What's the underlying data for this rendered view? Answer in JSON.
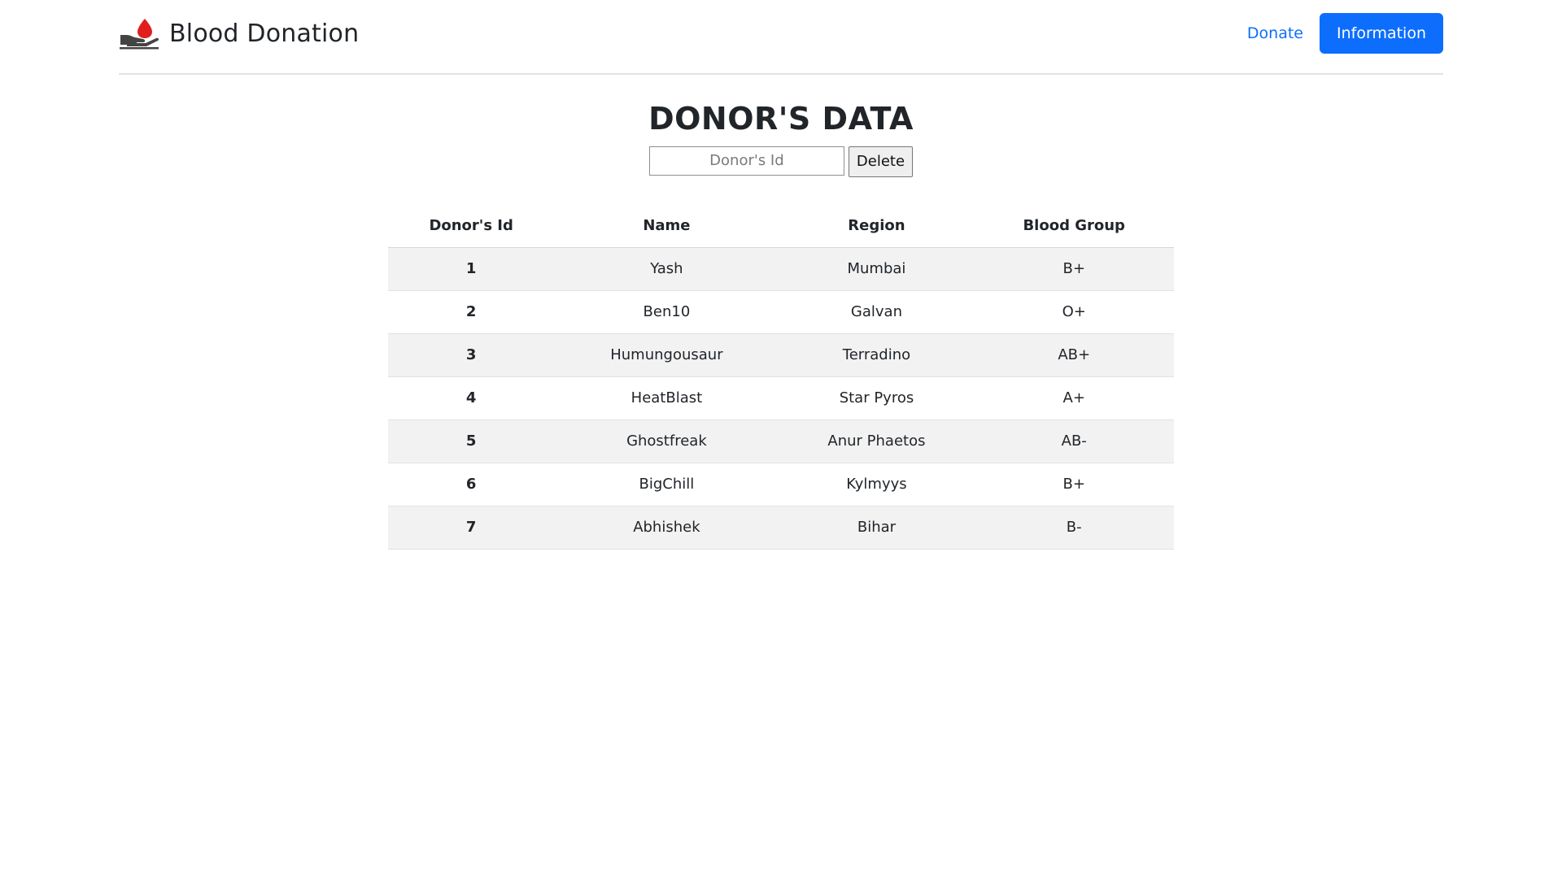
{
  "brand": {
    "title": "Blood Donation",
    "icon": "blood-drop-hand-icon",
    "drop_color": "#e01e1e",
    "hand_color": "#444444"
  },
  "nav": {
    "donate_label": "Donate",
    "information_label": "Information"
  },
  "page": {
    "title": "DONOR'S DATA"
  },
  "delete_form": {
    "placeholder": "Donor's Id",
    "value": "",
    "button_label": "Delete"
  },
  "table": {
    "headers": [
      "Donor's Id",
      "Name",
      "Region",
      "Blood Group"
    ],
    "rows": [
      {
        "id": "1",
        "name": "Yash",
        "region": "Mumbai",
        "blood_group": "B+"
      },
      {
        "id": "2",
        "name": "Ben10",
        "region": "Galvan",
        "blood_group": "O+"
      },
      {
        "id": "3",
        "name": "Humungousaur",
        "region": "Terradino",
        "blood_group": "AB+"
      },
      {
        "id": "4",
        "name": "HeatBlast",
        "region": "Star Pyros",
        "blood_group": "A+"
      },
      {
        "id": "5",
        "name": "Ghostfreak",
        "region": "Anur Phaetos",
        "blood_group": "AB-"
      },
      {
        "id": "6",
        "name": "BigChill",
        "region": "Kylmyys",
        "blood_group": "B+"
      },
      {
        "id": "7",
        "name": "Abhishek",
        "region": "Bihar",
        "blood_group": "B-"
      }
    ]
  },
  "colors": {
    "primary": "#0d6efd",
    "stripe": "#f2f2f2",
    "text": "#212529"
  }
}
